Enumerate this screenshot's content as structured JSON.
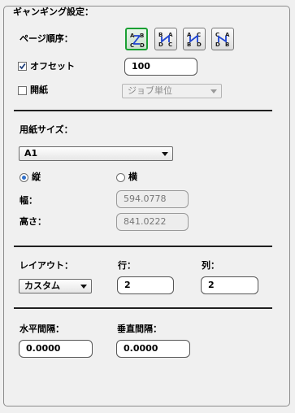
{
  "group": {
    "title": "ギャンギング設定："
  },
  "page_order": {
    "label": "ページ順序：",
    "buttons": [
      {
        "name": "abcd",
        "icon": "order-row-major-icon",
        "active": true
      },
      {
        "name": "bdac",
        "icon": "order-col-major-icon",
        "active": false
      },
      {
        "name": "acbd",
        "icon": "order-row-major-rtl-icon",
        "active": false
      },
      {
        "name": "cadb",
        "icon": "order-col-major-rtl-icon",
        "active": false
      }
    ]
  },
  "offset": {
    "label": "オフセット",
    "checked": true,
    "value": "100"
  },
  "spread": {
    "label": "開紙",
    "checked": false,
    "select_value": "ジョブ単位"
  },
  "paper_size": {
    "label": "用紙サイズ：",
    "value": "A1",
    "orientation": {
      "portrait_label": "縦",
      "landscape_label": "横",
      "selected": "portrait"
    },
    "width_label": "幅：",
    "width_value": "594.0778",
    "height_label": "高さ：",
    "height_value": "841.0222"
  },
  "layout": {
    "label": "レイアウト：",
    "value": "カスタム",
    "rows_label": "行：",
    "rows_value": "2",
    "cols_label": "列：",
    "cols_value": "2"
  },
  "spacing": {
    "horizontal_label": "水平間隔：",
    "horizontal_value": "0.0000",
    "vertical_label": "垂直間隔：",
    "vertical_value": "0.0000"
  },
  "colors": {
    "accent": "#1aa033",
    "icon_blue": "#2045d0",
    "radio_dot": "#2f6fc9"
  }
}
